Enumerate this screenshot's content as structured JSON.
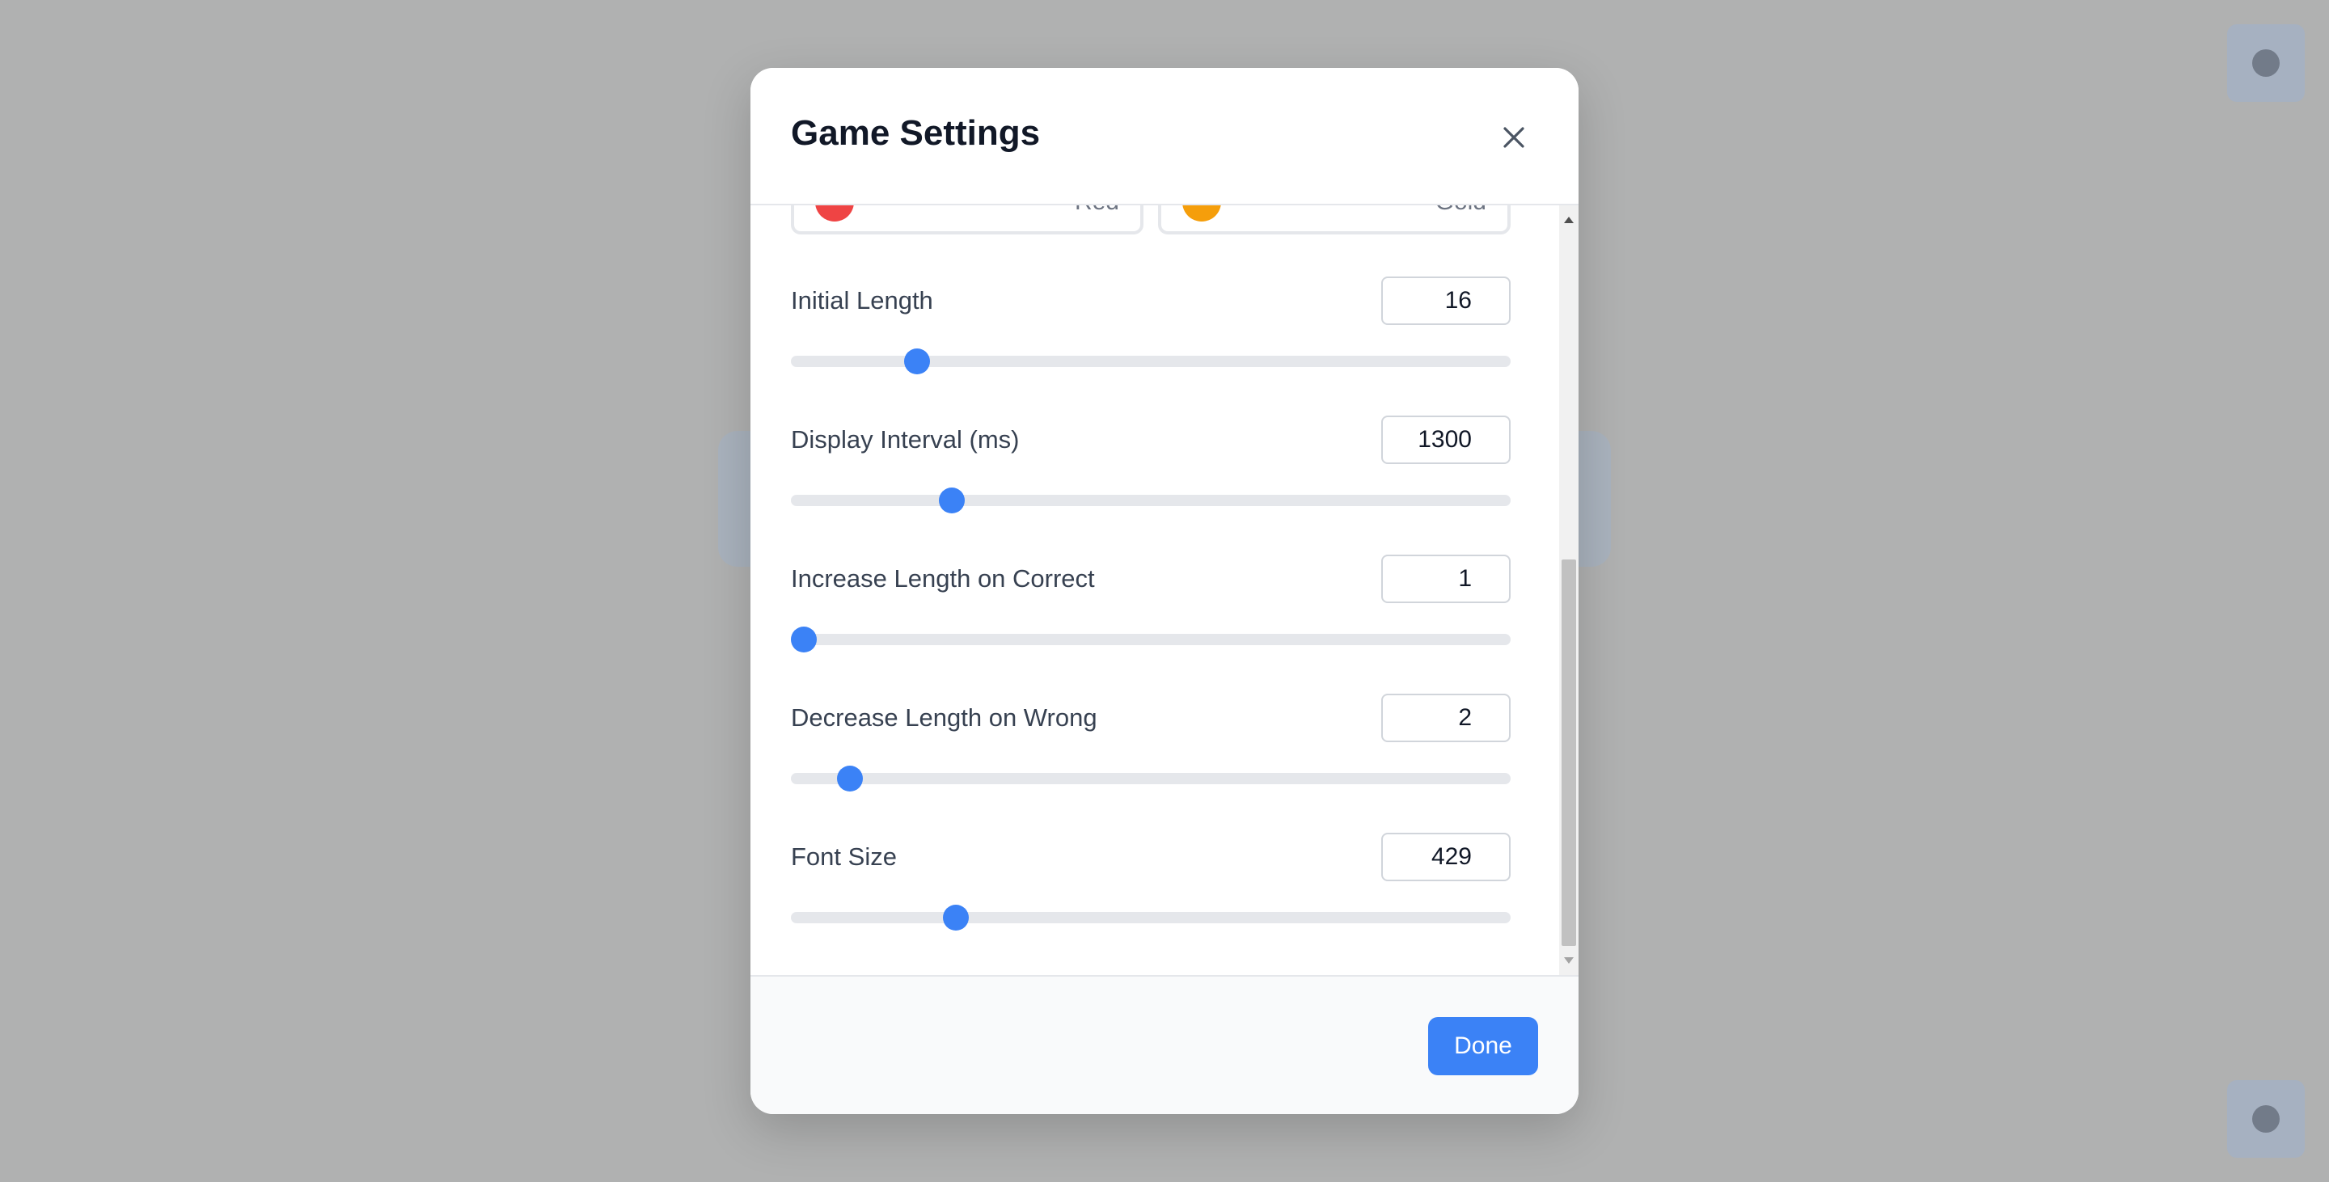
{
  "modal": {
    "title": "Game Settings",
    "done_label": "Done"
  },
  "colors": [
    {
      "name": "Red",
      "swatch": "#ef4444"
    },
    {
      "name": "Gold",
      "swatch": "#f59e0b"
    }
  ],
  "settings": [
    {
      "label": "Initial Length",
      "value": "16",
      "slider_fraction": 0.163
    },
    {
      "label": "Display Interval (ms)",
      "value": "1300",
      "slider_fraction": 0.213
    },
    {
      "label": "Increase Length on Correct",
      "value": "1",
      "slider_fraction": 0.0
    },
    {
      "label": "Decrease Length on Wrong",
      "value": "2",
      "slider_fraction": 0.066
    },
    {
      "label": "Font Size",
      "value": "429",
      "slider_fraction": 0.219
    }
  ],
  "accent_color": "#3b82f6"
}
